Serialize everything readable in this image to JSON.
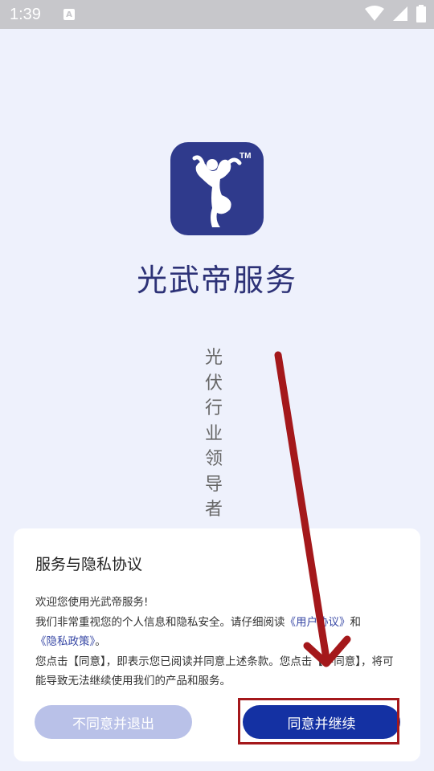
{
  "status_bar": {
    "time": "1:39",
    "notification_icon": "a-icon",
    "wifi_icon": "wifi-icon",
    "signal_icon": "cell-signal-icon",
    "battery_icon": "battery-icon"
  },
  "app": {
    "logo_icon": "guangwudi-logo",
    "logo_mark": "TM",
    "name": "光武帝服务",
    "slogan_chars": [
      "光",
      "伏",
      "行",
      "业",
      "领",
      "导",
      "者"
    ]
  },
  "dialog": {
    "title": "服务与隐私协议",
    "line1": "欢迎您使用光武帝服务!",
    "line2_prefix": "我们非常重视您的个人信息和隐私安全。请仔细阅读",
    "user_agreement_link": "《用户协议》",
    "line2_and": "和",
    "privacy_policy_link": "《隐私政策》",
    "line2_end": "。",
    "line3": "您点击【同意】，即表示您已阅读并同意上述条款。您点击【不同意】，将可能导致无法继续使用我们的产品和服务。",
    "disagree_button": "不同意并退出",
    "agree_button": "同意并继续"
  },
  "colors": {
    "brand": "#2d3277",
    "primary_button": "#1431a3",
    "disabled_button": "#b9c1e8",
    "annotation": "#a4181b"
  },
  "annotations": {
    "arrow_icon": "red-arrow-icon",
    "highlight": "red-highlight-box"
  }
}
